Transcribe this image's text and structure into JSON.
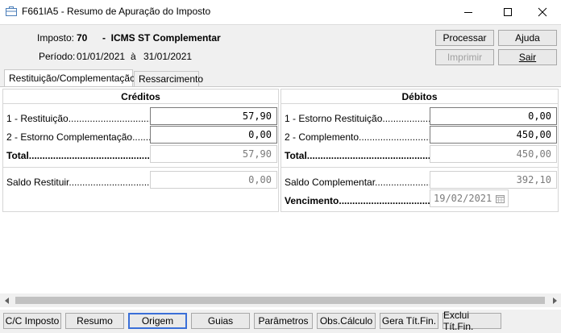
{
  "window": {
    "title": "F661IA5 - Resumo de Apuração do Imposto"
  },
  "header": {
    "imposto_label": "Imposto:",
    "imposto_code": "70",
    "imposto_name": "-  ICMS ST Complementar",
    "periodo_label": "Período:",
    "periodo_start": "01/01/2021",
    "periodo_sep": "à",
    "periodo_end": "31/01/2021"
  },
  "actions": {
    "processar": "Processar",
    "ajuda": "Ajuda",
    "imprimir": "Imprimir",
    "sair": "Sair"
  },
  "tabs": [
    {
      "label": "Restituição/Complementação",
      "active": true
    },
    {
      "label": "Ressarcimento",
      "active": false
    }
  ],
  "creditos": {
    "title": "Créditos",
    "rows": [
      {
        "label": "1 - Restituição.......................................",
        "value": "57,90"
      },
      {
        "label": "2 - Estorno Complementação...........................",
        "value": "0,00"
      }
    ],
    "total_label": "Total.......................................................",
    "total_value": "57,90",
    "saldo_label": "Saldo Restituir.....................................",
    "saldo_value": "0,00"
  },
  "debitos": {
    "title": "Débitos",
    "rows": [
      {
        "label": "1 - Estorno Restituição..........................",
        "value": "0,00"
      },
      {
        "label": "2 - Complemento..............................................",
        "value": "450,00"
      }
    ],
    "total_label": "Total.......................................................",
    "total_value": "450,00",
    "saldo_label": "Saldo Complementar.........................",
    "saldo_value": "392,10",
    "vencimento_label": "Vencimento..........................................",
    "vencimento_value": "19/02/2021"
  },
  "toolbar": {
    "cc_imposto": "C/C Imposto",
    "resumo": "Resumo",
    "origem": "Origem",
    "guias": "Guias",
    "parametros": "Parâmetros",
    "obs_calculo": "Obs.Cálculo",
    "gera_tit": "Gera Tít.Fin.",
    "exclui_tit": "Exclui Tít.Fin."
  }
}
